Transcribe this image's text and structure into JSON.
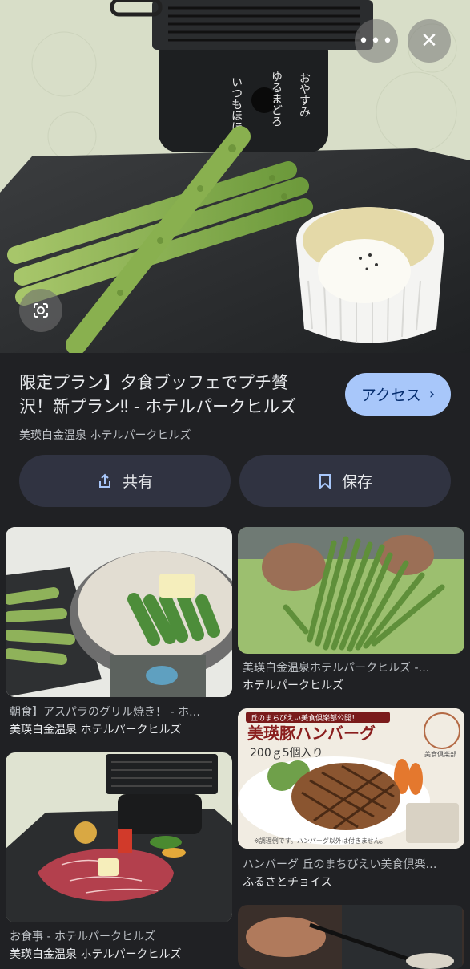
{
  "top_actions": {
    "more_icon": "more-horizontal-icon",
    "close_icon": "close-icon"
  },
  "lens": {
    "icon": "lens-icon"
  },
  "result": {
    "title": "限定プラン】夕食ブッフェでプチ贅沢！新プラン‼ - ホテルパークヒルズ",
    "title_line1": "限定プラン】夕食ブッフェでプチ贅",
    "title_line2": "沢！新プラン‼ - ホテルパークヒルズ",
    "source": "美瑛白金温泉 ホテルパークヒルズ",
    "access_label": "アクセス",
    "share_label": "共有",
    "save_label": "保存"
  },
  "related": [
    {
      "caption": "朝食】アスパラのグリル焼き！ - ホ…",
      "source": "美瑛白金温泉 ホテルパークヒルズ"
    },
    {
      "caption": "美瑛白金温泉ホテルパークヒルズ -…",
      "source": "ホテルパークヒルズ"
    },
    {
      "caption": "ハンバーグ 丘のまちびえい美食倶楽…",
      "source": "ふるさとチョイス",
      "image_text_title": "美瑛豚ハンバーグ",
      "image_text_sub": "200ｇ5個入り",
      "image_text_banner": "丘のまちびえい美食倶楽部公開！",
      "image_text_note": "※調理例です。ハンバーグ以外は付きません。",
      "image_text_brand": "美食倶楽部"
    },
    {
      "caption": "お食事 - ホテルパークヒルズ",
      "source": "美瑛白金温泉 ホテルパークヒルズ"
    }
  ],
  "hero_text": {
    "vertical_1": "いつもほほ",
    "vertical_2": "ゆるまどろ",
    "vertical_3": "おやすみ"
  },
  "colors": {
    "accent": "#a8c7fa",
    "background": "#202124",
    "button_bg": "#303341"
  }
}
